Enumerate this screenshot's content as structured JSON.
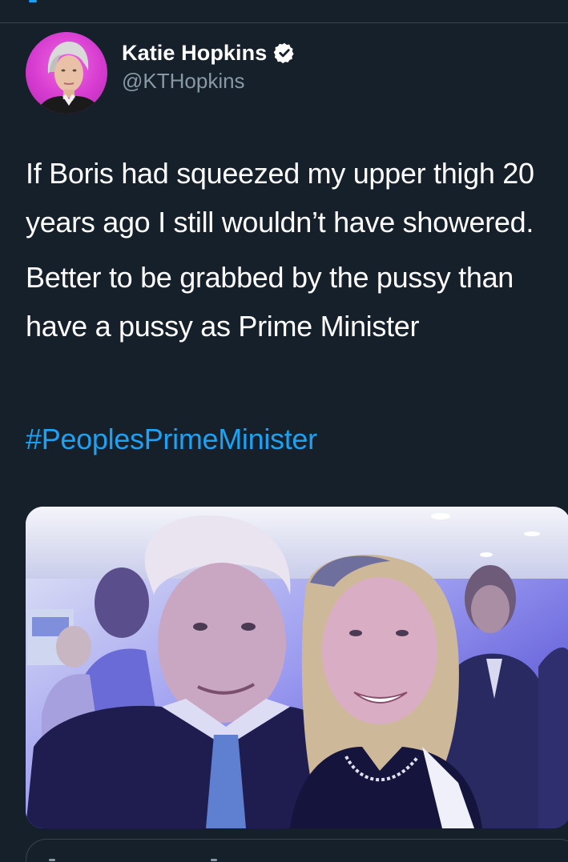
{
  "colors": {
    "background": "#15202b",
    "text": "#ffffff",
    "muted": "#8899a6",
    "accent": "#1da1f2"
  },
  "author": {
    "display_name": "Katie Hopkins",
    "handle": "@KTHopkins",
    "verified": true,
    "verified_icon": "verified-badge-icon"
  },
  "tweet": {
    "paragraphs": [
      "If Boris had squeezed my upper thigh 20 years ago I still wouldn’t have showered.",
      "Better to be grabbed by the pussy than have a pussy as Prime Minister"
    ],
    "hashtag": "#PeoplesPrimeMinister"
  },
  "media": {
    "type": "photo"
  }
}
